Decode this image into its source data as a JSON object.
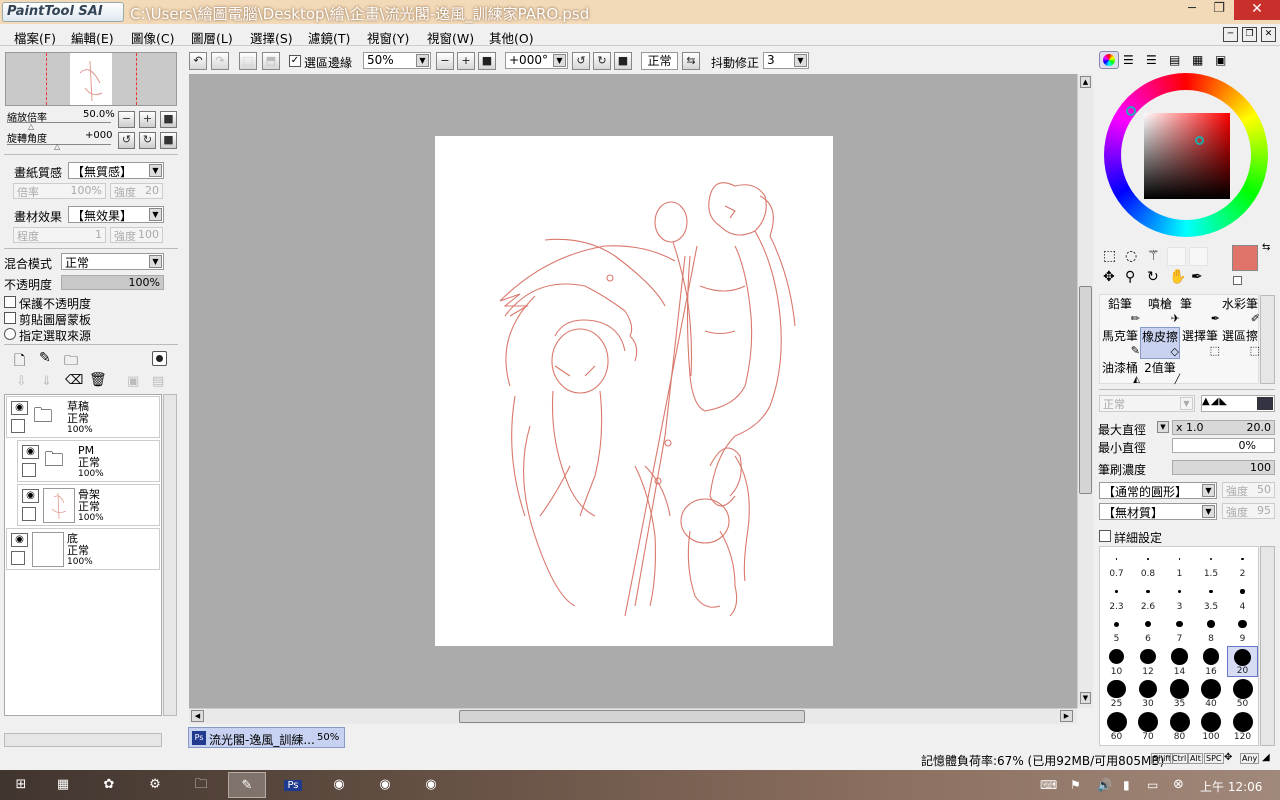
{
  "window": {
    "logo_text": "PaintTool SAI",
    "title": "C:\\Users\\繪圖電腦\\Desktop\\繪\\企畫\\流光閣-逸風_訓練家PARO.psd",
    "minimize": "─",
    "restore": "❐",
    "close": "✕"
  },
  "menu": [
    "檔案(F)",
    "編輯(E)",
    "圖像(C)",
    "圖層(L)",
    "選擇(S)",
    "濾鏡(T)",
    "視窗(Y)",
    "視窗(W)",
    "其他(O)"
  ],
  "navigator": {
    "zoom_label": "縮放倍率",
    "zoom_value": "50.0%",
    "rotate_label": "旋轉角度",
    "rotate_value": "+000"
  },
  "paper_texture": {
    "label": "畫紙質感",
    "value": "【無質感】",
    "rate_label": "倍率",
    "rate_value": "100%",
    "strength_label": "強度",
    "strength_value": "20"
  },
  "brush_effect": {
    "label": "畫材效果",
    "value": "【無效果】",
    "degree_label": "程度",
    "degree_value": "1",
    "strength_label": "強度",
    "strength_value": "100"
  },
  "blend": {
    "label": "混合模式",
    "value": "正常"
  },
  "opacity": {
    "label": "不透明度",
    "value": "100%",
    "fraction": 1.0
  },
  "checkboxes": {
    "protect_opacity": "保護不透明度",
    "clipping": "剪貼圖層蒙板",
    "selection_source": "指定選取來源"
  },
  "layers": [
    {
      "name": "草稿",
      "mode": "正常",
      "opacity": "100%",
      "type": "folder",
      "visible": true
    },
    {
      "name": "PM",
      "mode": "正常",
      "opacity": "100%",
      "type": "folder",
      "visible": true
    },
    {
      "name": "骨架",
      "mode": "正常",
      "opacity": "100%",
      "type": "layer",
      "visible": true
    },
    {
      "name": "底",
      "mode": "正常",
      "opacity": "100%",
      "type": "layer",
      "visible": true
    }
  ],
  "toolbar": {
    "selection_edge_label": "選區邊緣",
    "zoom": "50%",
    "angle": "+000°",
    "mode": "正常",
    "stabilizer_label": "抖動修正",
    "stabilizer_value": "3"
  },
  "tools": {
    "tool_names": [
      "鉛筆",
      "噴槍",
      "筆",
      "水彩筆",
      "馬克筆",
      "橡皮擦",
      "選擇筆",
      "選區擦",
      "油漆桶",
      "2值筆"
    ],
    "selected_tool": "橡皮擦",
    "brush_mode": "正常",
    "max_size_label": "最大直徑",
    "max_size_mult": "x 1.0",
    "max_size_value": "20.0",
    "min_size_label": "最小直徑",
    "min_size_value": "0%",
    "density_label": "筆刷濃度",
    "density_value": "100",
    "shape_value": "【通常的圓形】",
    "shape_strength_label": "強度",
    "shape_strength_value": "50",
    "texture_value": "【無材質】",
    "texture_strength_label": "強度",
    "texture_strength_value": "95",
    "detail_label": "詳細設定"
  },
  "brush_sizes": [
    "0.7",
    "0.8",
    "1",
    "1.5",
    "2",
    "2.3",
    "2.6",
    "3",
    "3.5",
    "4",
    "5",
    "6",
    "7",
    "8",
    "9",
    "10",
    "12",
    "14",
    "16",
    "20",
    "25",
    "30",
    "35",
    "40",
    "50",
    "60",
    "70",
    "80",
    "100",
    "120"
  ],
  "selected_brush_size": "20",
  "colors": {
    "primary": "#e0736a",
    "secondary": "#ffffff",
    "sketch_line": "#d9786c",
    "title_bar": "#f2d9b8",
    "close_button": "#c9302c"
  },
  "document_tab": {
    "name": "流光閣-逸風_訓練...",
    "zoom": "50%"
  },
  "status": {
    "memory": "記憶體負荷率:67% (已用92MB/可用805MB)",
    "keys": [
      "Shift",
      "Ctrl",
      "Alt",
      "SPC",
      "Any"
    ]
  },
  "taskbar": {
    "clock": "上午 12:06"
  }
}
